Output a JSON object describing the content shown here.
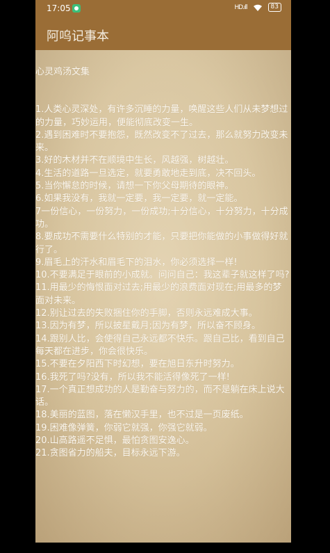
{
  "status_bar": {
    "time": "17:05",
    "signal": "HD.ıll",
    "battery": "83"
  },
  "app_bar": {
    "title": "阿呜记事本"
  },
  "note": {
    "heading": "心灵鸡汤文集",
    "lines": [
      "1.人类心灵深处，有许多沉睡的力量，唤醒这些人们从未梦想过的力量，巧妙运用，便能彻底改变一生。",
      "2.遇到困难时不要抱怨，既然改变不了过去，那么就努力改变未来。",
      "3.好的木材并不在顺境中生长，风越强，树越壮。",
      "4.生活的道路一旦选定，就要勇敢地走到底，决不回头。",
      "5.当你懈怠的时候，请想一下你父母期待的眼神。",
      "6.如果我没有，我就一定要，我一定要，就一定能。",
      "7一份信心，一份努力，一份成功;十分信心，十分努力，十分成功。",
      "8.要成功不需要什么特别的才能，只要把你能做的小事做得好就行了。",
      "9.眉毛上的汗水和眉毛下的泪水，你必须选择一样!",
      "10.不要满足于眼前的小成就。问问自己：我这辈子就这样了吗?",
      "11.用最少的悔恨面对过去;用最少的浪费面对现在;用最多的梦面对未来。",
      "12.别让过去的失败捆住你的手脚，否则永远难成大事。",
      "13.因为有梦，所以披星戴月;因为有梦，所以奋不顾身。",
      "14.跟别人比，会使得自己永远都不快乐。跟自己比，看到自己每天都在进步，你会很快乐。",
      "15.不要在夕阳西下时幻想，要在旭日东升时努力。",
      "16.我死了吗?没有，所以我不能活得像死了一样!",
      "17.一个真正想成功的人是勤奋与努力的，而不是躺在床上说大话。",
      "18.美丽的蓝图，落在懒汉手里，也不过是一页废纸。",
      "19.困难像弹簧，你弱它就强，你强它就弱。",
      "20.山高路遥不足惧，最怕贪图安逸心。",
      "21.贪图省力的船夫，目标永远下游。"
    ]
  }
}
